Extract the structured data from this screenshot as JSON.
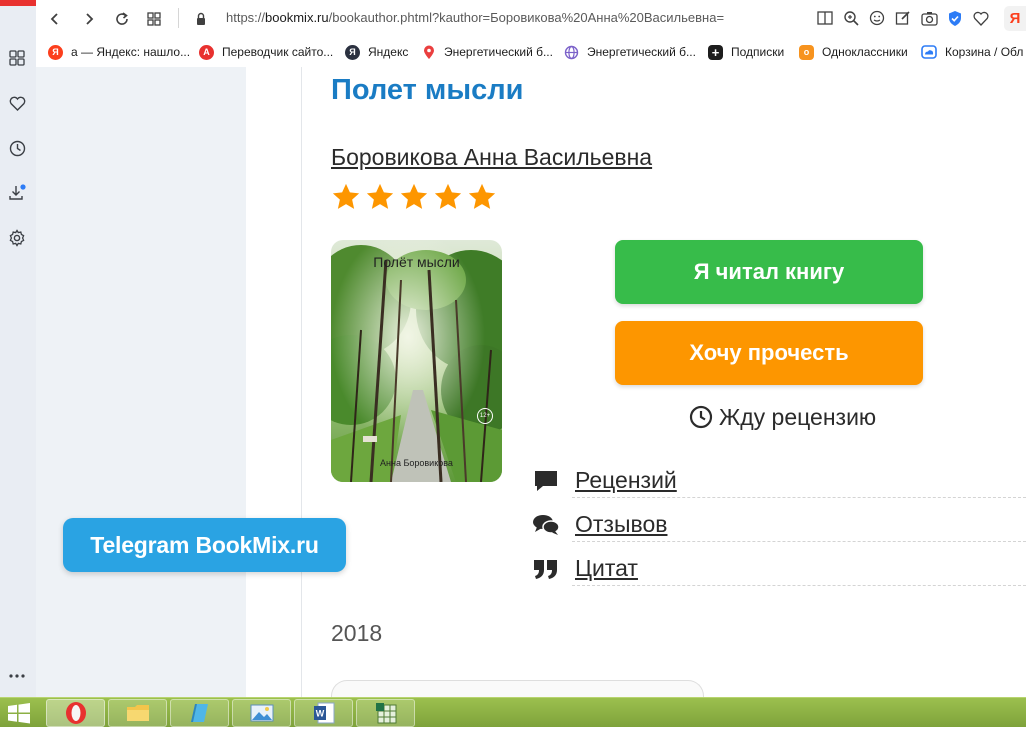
{
  "browser": {
    "url_prefix": "https://",
    "url_host": "bookmix.ru",
    "url_rest": "/bookauthor.phtml?kauthor=Боровикова%20Анна%20Васильевна=",
    "bookmarks": [
      {
        "label": "а — Яндекс: нашло...",
        "icon": "yandex-icon",
        "color": "#fc3f1d",
        "glyph": "Я"
      },
      {
        "label": "Переводчик сайто...",
        "icon": "translator-icon",
        "color": "#e8312f",
        "glyph": "A"
      },
      {
        "label": "Яндекс",
        "icon": "yandex-icon",
        "color": "#2b3140",
        "glyph": "Я"
      },
      {
        "label": "Энергетический б...",
        "icon": "map-pin-icon",
        "color": "#ea3f3f",
        "glyph": ""
      },
      {
        "label": "Энергетический б...",
        "icon": "globe-icon",
        "color": "#7b61c9",
        "glyph": ""
      },
      {
        "label": "Подписки",
        "icon": "plus-icon",
        "color": "#1d1d1d",
        "glyph": "+"
      },
      {
        "label": "Одноклассники",
        "icon": "odnoklassniki-icon",
        "color": "#f7931e",
        "glyph": "о"
      },
      {
        "label": "Корзина / Обл",
        "icon": "cloud-icon",
        "color": "#2d7cf6",
        "glyph": ""
      }
    ]
  },
  "page": {
    "title": "Полет мысли",
    "author": "Боровикова Анна Васильевна",
    "rating_stars": 5,
    "cover": {
      "title": "Полёт мысли",
      "author": "Анна Боровикова",
      "age": "12+"
    },
    "buttons": {
      "read": "Я читал книгу",
      "want": "Хочу прочесть"
    },
    "await_review": "Жду рецензию",
    "stats": [
      {
        "label": "Рецензий",
        "icon": "comment-icon"
      },
      {
        "label": "Отзывов",
        "icon": "comments-icon"
      },
      {
        "label": "Цитат",
        "icon": "quote-icon"
      }
    ],
    "telegram": "Telegram BookMix.ru",
    "year": "2018"
  },
  "colors": {
    "title": "#1a7cc4",
    "star": "#fd9600",
    "read_button": "#37bc4a",
    "want_button": "#fd9600",
    "telegram": "#2aa3e3"
  }
}
